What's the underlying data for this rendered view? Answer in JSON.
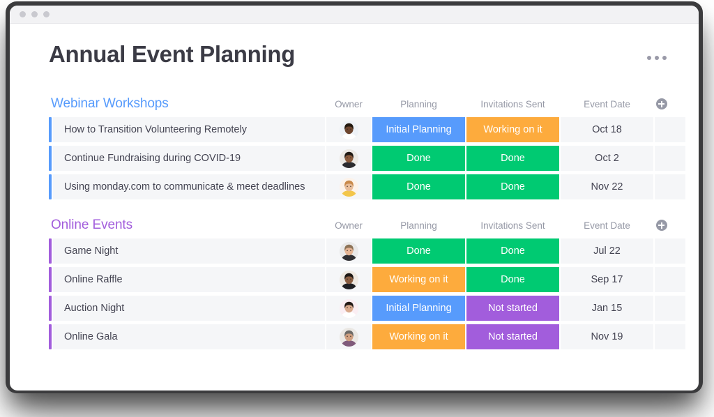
{
  "window": {
    "traffic_dots": [
      "dot-1",
      "dot-2",
      "dot-3"
    ]
  },
  "header": {
    "title": "Annual Event Planning",
    "menu_icon": "kebab-menu-icon"
  },
  "columns": {
    "name": "",
    "owner": "Owner",
    "planning": "Planning",
    "invitations": "Invitations Sent",
    "event_date": "Event Date",
    "add": "add-column-icon"
  },
  "colors": {
    "blue": "#579bfc",
    "green": "#00ca72",
    "orange": "#fdab3d",
    "purple": "#a25ddc",
    "row_bg": "#f5f6f8",
    "title_text": "#3b3b45",
    "header_text": "#9699a6"
  },
  "status_labels": {
    "initial_planning": "Initial Planning",
    "working_on_it": "Working on it",
    "done": "Done",
    "not_started": "Not started"
  },
  "groups": [
    {
      "title": "Webinar Workshops",
      "color": "blue",
      "rows": [
        {
          "name": "How to Transition Volunteering Remotely",
          "owner": "avatar-woman-glasses",
          "planning": {
            "label": "Initial Planning",
            "color": "#579bfc"
          },
          "invitations": {
            "label": "Working on it",
            "color": "#fdab3d"
          },
          "date": "Oct 18"
        },
        {
          "name": "Continue Fundraising during COVID-19",
          "owner": "avatar-man-beard-dark",
          "planning": {
            "label": "Done",
            "color": "#00ca72"
          },
          "invitations": {
            "label": "Done",
            "color": "#00ca72"
          },
          "date": "Oct 2"
        },
        {
          "name": "Using monday.com to communicate & meet deadlines",
          "owner": "avatar-woman-blonde",
          "planning": {
            "label": "Done",
            "color": "#00ca72"
          },
          "invitations": {
            "label": "Done",
            "color": "#00ca72"
          },
          "date": "Nov 22"
        }
      ]
    },
    {
      "title": "Online Events",
      "color": "purple",
      "rows": [
        {
          "name": "Game Night",
          "owner": "avatar-man-light-beard",
          "planning": {
            "label": "Done",
            "color": "#00ca72"
          },
          "invitations": {
            "label": "Done",
            "color": "#00ca72"
          },
          "date": "Jul 22"
        },
        {
          "name": "Online Raffle",
          "owner": "avatar-man-dark-beard",
          "planning": {
            "label": "Working on it",
            "color": "#fdab3d"
          },
          "invitations": {
            "label": "Done",
            "color": "#00ca72"
          },
          "date": "Sep 17"
        },
        {
          "name": "Auction Night",
          "owner": "avatar-woman-dark-hair",
          "planning": {
            "label": "Initial Planning",
            "color": "#579bfc"
          },
          "invitations": {
            "label": "Not started",
            "color": "#a25ddc"
          },
          "date": "Jan 15"
        },
        {
          "name": "Online Gala",
          "owner": "avatar-man-gray-beard",
          "planning": {
            "label": "Working on it",
            "color": "#fdab3d"
          },
          "invitations": {
            "label": "Not started",
            "color": "#a25ddc"
          },
          "date": "Nov 19"
        }
      ]
    }
  ]
}
